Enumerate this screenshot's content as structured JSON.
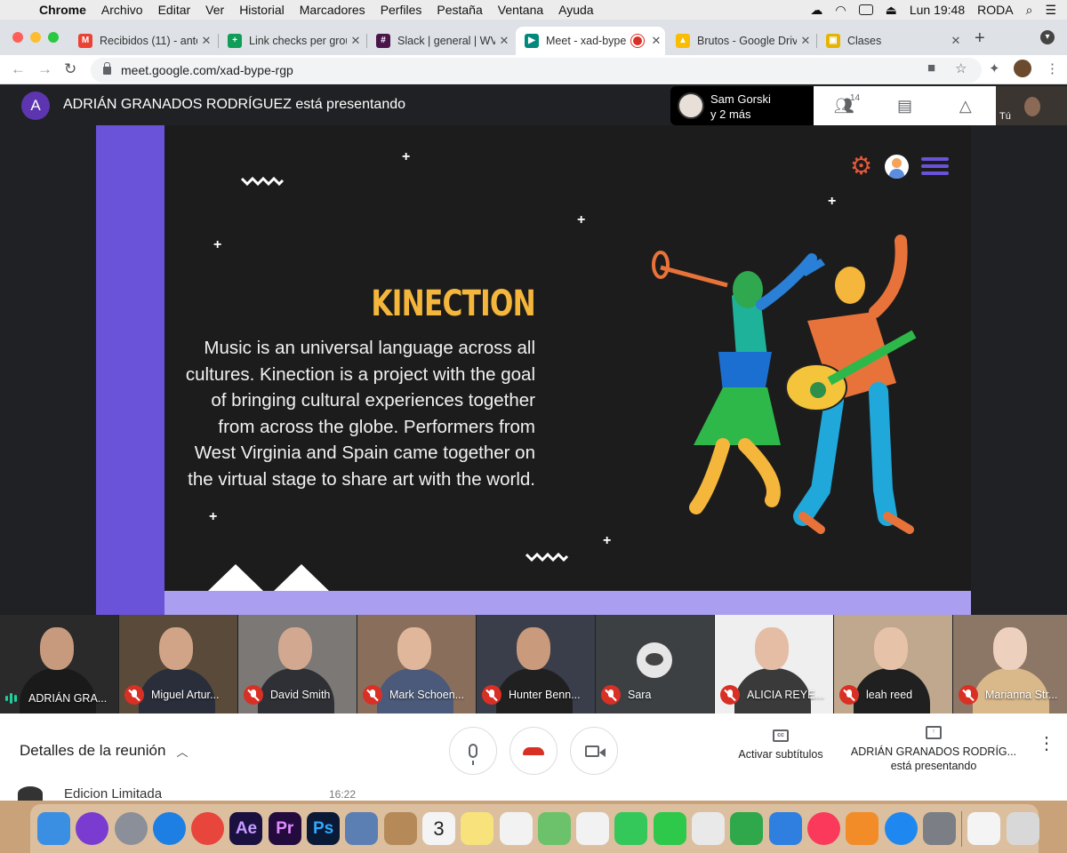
{
  "menubar": {
    "app": "Chrome",
    "items": [
      "Archivo",
      "Editar",
      "Ver",
      "Historial",
      "Marcadores",
      "Perfiles",
      "Pestaña",
      "Ventana",
      "Ayuda"
    ],
    "clock": "Lun 19:48",
    "user": "RODA"
  },
  "tabs": [
    {
      "title": "Recibidos (11) - anto",
      "color": "#ea4335",
      "glyph": "M"
    },
    {
      "title": "Link checks per grou",
      "color": "#0f9d58",
      "glyph": "+"
    },
    {
      "title": "Slack | general | WV",
      "color": "#4a154b",
      "glyph": "#"
    },
    {
      "title": "Meet - xad-bype",
      "color": "#00897b",
      "glyph": "▶"
    },
    {
      "title": "Brutos - Google Drive",
      "color": "#fbbc04",
      "glyph": "▲"
    },
    {
      "title": "Clases",
      "color": "#e4b400",
      "glyph": "▣"
    }
  ],
  "address": {
    "url": "meet.google.com/xad-bype-rgp"
  },
  "meet": {
    "presenter_initial": "A",
    "presenter_text": "ADRIÁN GRANADOS RODRÍGUEZ está presentando",
    "pinned_name": "Sam Gorski",
    "pinned_more": "y 2 más",
    "participant_count": "14",
    "self_label": "Tú"
  },
  "slide": {
    "title": "KINECTION",
    "body": "Music is an universal language across all cultures. Kinection is a project with the goal of bringing cultural experiences together from across the globe. Performers from West Virginia and Spain came together on the virtual stage to share art with the world."
  },
  "participants": [
    {
      "name": "ADRIÁN GRA...",
      "speaking": true,
      "bg": "#2a2a2a",
      "skin": "#c79a7d",
      "shirt": "#1a1a1a"
    },
    {
      "name": "Miguel Artur...",
      "speaking": false,
      "bg": "#5a4a3a",
      "skin": "#d1a487",
      "shirt": "#2a2e3a"
    },
    {
      "name": "David Smith",
      "speaking": false,
      "bg": "#7b7876",
      "skin": "#d2a890",
      "shirt": "#2f3035"
    },
    {
      "name": "Mark Schoen...",
      "speaking": false,
      "bg": "#8a6e5c",
      "skin": "#e0b79b",
      "shirt": "#4b5a7a"
    },
    {
      "name": "Hunter Benn...",
      "speaking": false,
      "bg": "#3a3e4a",
      "skin": "#c99a7b",
      "shirt": "#202020"
    },
    {
      "name": "Sara",
      "speaking": false,
      "bg": "#3c4043",
      "avatar": true
    },
    {
      "name": "ALICIA REYE...",
      "speaking": false,
      "bg": "#efefef",
      "skin": "#e4bda4",
      "shirt": "#3a3a3a"
    },
    {
      "name": "leah reed",
      "speaking": false,
      "bg": "#bfa88e",
      "skin": "#e6c3a8",
      "shirt": "#202020"
    },
    {
      "name": "Marianna Str...",
      "speaking": false,
      "bg": "#8c7666",
      "skin": "#edd0be",
      "shirt": "#d9b88a"
    }
  ],
  "controls": {
    "details": "Detalles de la reunión",
    "captions": "Activar subtítulos",
    "presenting_line1": "ADRIÁN GRANADOS RODRÍG...",
    "presenting_line2": "está presentando"
  },
  "behind": {
    "title": "Edicion Limitada",
    "time": "16:22"
  },
  "dock": [
    {
      "name": "finder",
      "color": "#3b8fe3"
    },
    {
      "name": "siri",
      "color": "#7a3bd1"
    },
    {
      "name": "launchpad",
      "color": "#8a8f99"
    },
    {
      "name": "safari",
      "color": "#1d7fe3"
    },
    {
      "name": "chrome",
      "color": "#e8453c"
    },
    {
      "name": "after-effects",
      "color": "#1b1140",
      "label": "Ae"
    },
    {
      "name": "premiere",
      "color": "#230b3d",
      "label": "Pr"
    },
    {
      "name": "photoshop",
      "color": "#0a1a36",
      "label": "Ps"
    },
    {
      "name": "preview",
      "color": "#5b7fb3"
    },
    {
      "name": "contacts",
      "color": "#b58a58"
    },
    {
      "name": "calendar",
      "color": "#f4f4f4",
      "label": "3"
    },
    {
      "name": "notes",
      "color": "#f7e27c"
    },
    {
      "name": "reminders",
      "color": "#f2f2f2"
    },
    {
      "name": "maps",
      "color": "#6cc26a"
    },
    {
      "name": "photos",
      "color": "#f2f2f2"
    },
    {
      "name": "messages",
      "color": "#34c759"
    },
    {
      "name": "facetime",
      "color": "#2ec94a"
    },
    {
      "name": "keynote-doc",
      "color": "#e9e9e9"
    },
    {
      "name": "numbers",
      "color": "#2ea84a"
    },
    {
      "name": "keynote",
      "color": "#2f7fe0"
    },
    {
      "name": "music",
      "color": "#fb3a5b"
    },
    {
      "name": "books",
      "color": "#f28c28"
    },
    {
      "name": "app-store",
      "color": "#1e88f0"
    },
    {
      "name": "system-preferences",
      "color": "#7b7f85"
    },
    {
      "name": "html-file",
      "color": "#f4f4f4"
    },
    {
      "name": "trash",
      "color": "#d8d8d8"
    }
  ]
}
